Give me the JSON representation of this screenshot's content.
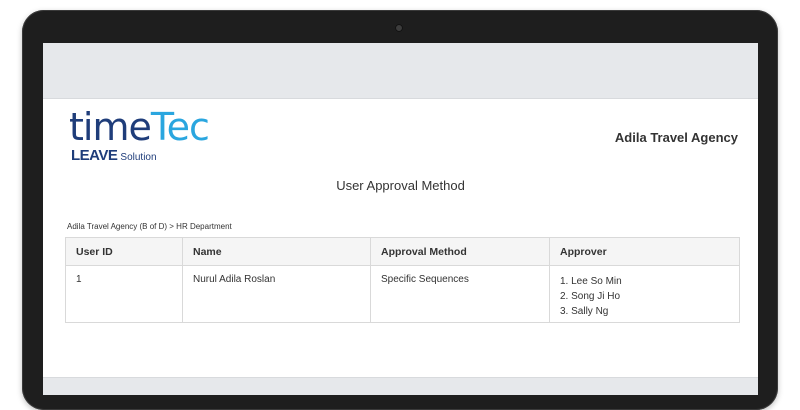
{
  "logo": {
    "time": "time",
    "tec": "Tec",
    "leave": "LEAVE",
    "solution": "Solution"
  },
  "company_name": "Adila Travel Agency",
  "report_title": "User Approval Method",
  "breadcrumb": "Adila Travel Agency (B of D) > HR Department",
  "table": {
    "headers": [
      "User ID",
      "Name",
      "Approval Method",
      "Approver"
    ],
    "rows": [
      {
        "user_id": "1",
        "name": "Nurul Adila Roslan",
        "approval_method": "Specific Sequences",
        "approvers": [
          "1. Lee So Min",
          "2. Song Ji Ho",
          "3. Sally Ng"
        ]
      }
    ]
  },
  "colors": {
    "logo_dark": "#1f3d7a",
    "logo_accent": "#2aa6df",
    "frame": "#1e1e1e",
    "screen_bg": "#e6e8eb"
  }
}
